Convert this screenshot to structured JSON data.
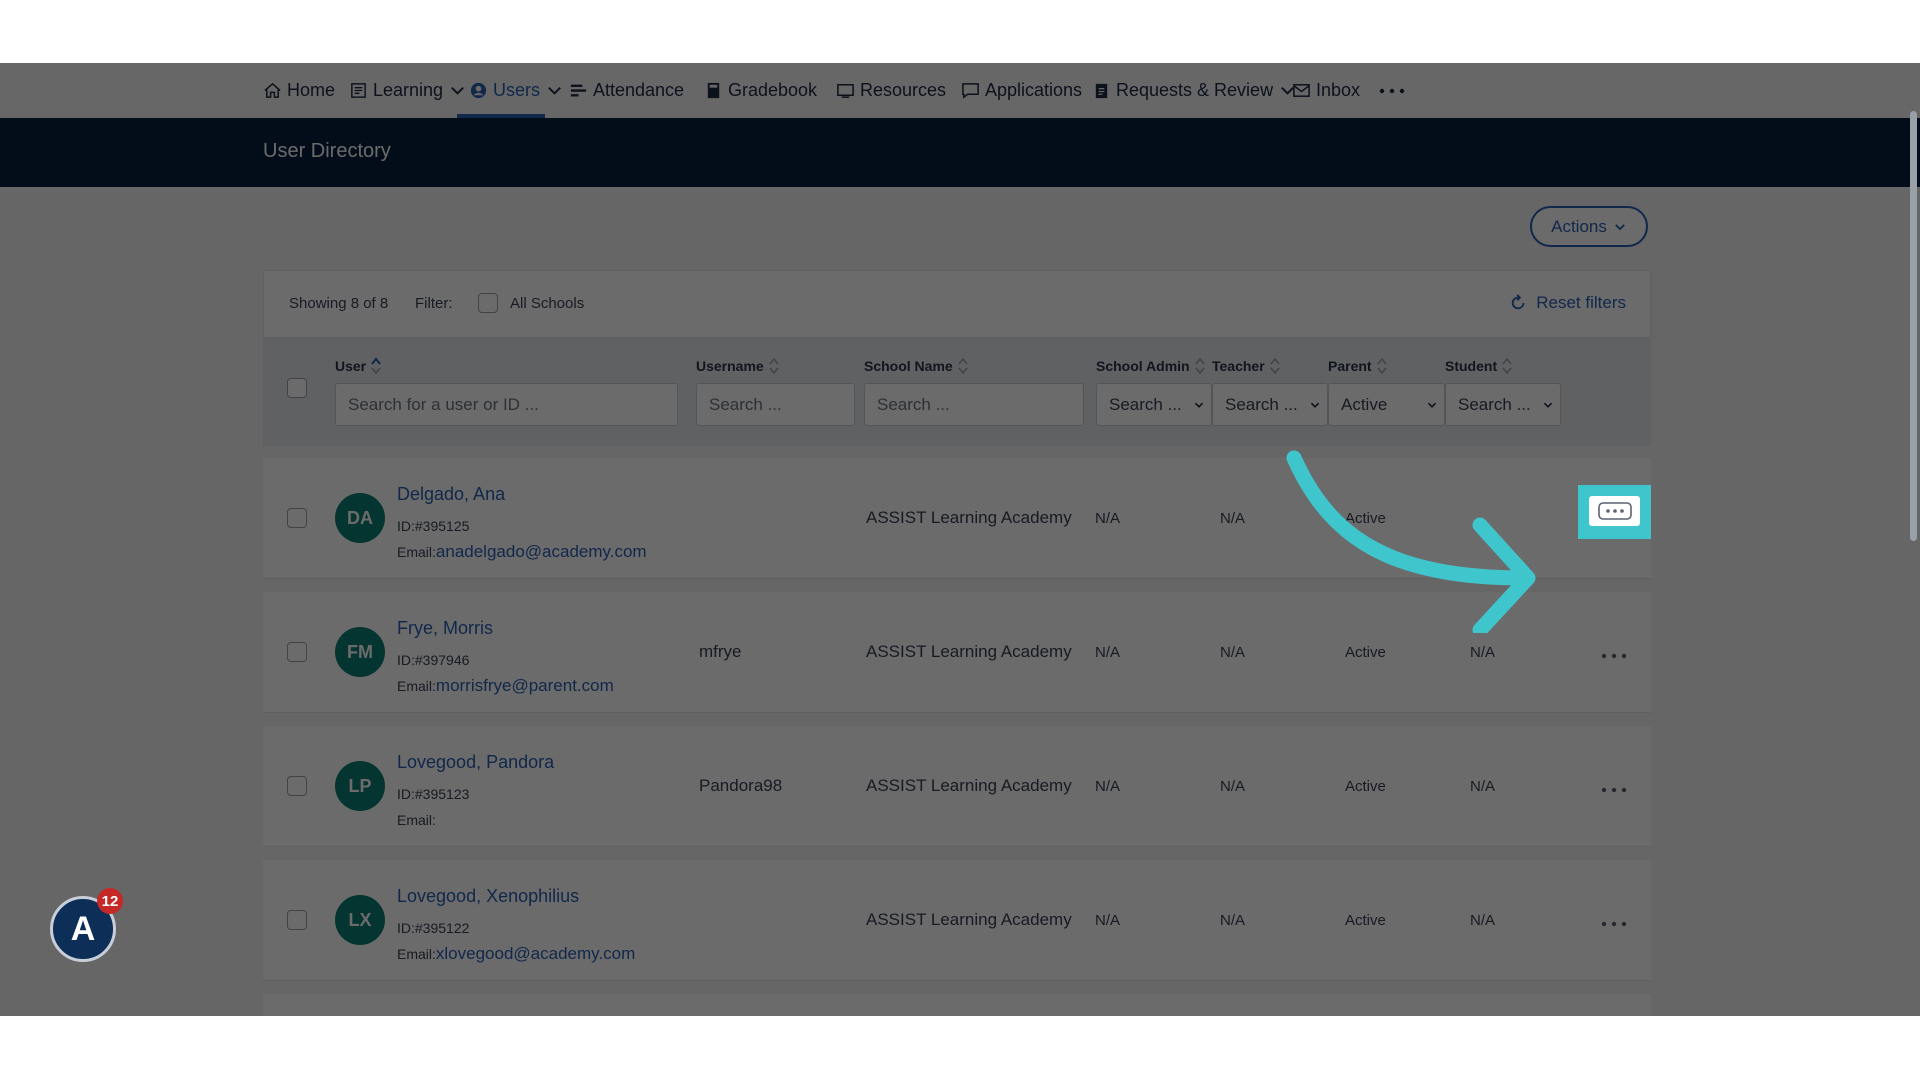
{
  "nav": {
    "home": "Home",
    "learning": "Learning",
    "users": "Users",
    "attendance": "Attendance",
    "gradebook": "Gradebook",
    "resources": "Resources",
    "applications": "Applications",
    "requests": "Requests & Review",
    "inbox": "Inbox"
  },
  "header": {
    "title": "User Directory"
  },
  "actions_label": "Actions",
  "filter_bar": {
    "showing": "Showing 8 of 8",
    "filter_label": "Filter:",
    "all_schools": "All Schools",
    "reset": "Reset filters"
  },
  "columns": {
    "user": "User",
    "username": "Username",
    "school_name": "School Name",
    "school_admin": "School Admin",
    "teacher": "Teacher",
    "parent": "Parent",
    "student": "Student"
  },
  "search": {
    "user_placeholder": "Search for a user or ID ...",
    "username_placeholder": "Search ...",
    "school_placeholder": "Search ...",
    "admin_value": "Search ...",
    "teacher_value": "Search ...",
    "parent_value": "Active",
    "student_value": "Search ..."
  },
  "rows": [
    {
      "initials": "DA",
      "name": "Delgado, Ana",
      "id": "ID:#395125",
      "email_label": "Email:",
      "email": "anadelgado@academy.com",
      "username": "",
      "school": "ASSIST Learning Academy",
      "admin": "N/A",
      "teacher": "N/A",
      "parent": "Active",
      "student": ""
    },
    {
      "initials": "FM",
      "name": "Frye, Morris",
      "id": "ID:#397946",
      "email_label": "Email:",
      "email": "morrisfrye@parent.com",
      "username": "mfrye",
      "school": "ASSIST Learning Academy",
      "admin": "N/A",
      "teacher": "N/A",
      "parent": "Active",
      "student": "N/A"
    },
    {
      "initials": "LP",
      "name": "Lovegood, Pandora",
      "id": "ID:#395123",
      "email_label": "Email:",
      "email": "",
      "username": "Pandora98",
      "school": "ASSIST Learning Academy",
      "admin": "N/A",
      "teacher": "N/A",
      "parent": "Active",
      "student": "N/A"
    },
    {
      "initials": "LX",
      "name": "Lovegood, Xenophilius",
      "id": "ID:#395122",
      "email_label": "Email:",
      "email": "xlovegood@academy.com",
      "username": "",
      "school": "ASSIST Learning Academy",
      "admin": "N/A",
      "teacher": "N/A",
      "parent": "Active",
      "student": "N/A"
    }
  ],
  "badge": {
    "count": "12",
    "letter": "A"
  },
  "colors": {
    "accent": "#2b5fb4",
    "header_bg": "#05213d",
    "avatar": "#0c7f74",
    "highlight": "#3fc6cc"
  }
}
